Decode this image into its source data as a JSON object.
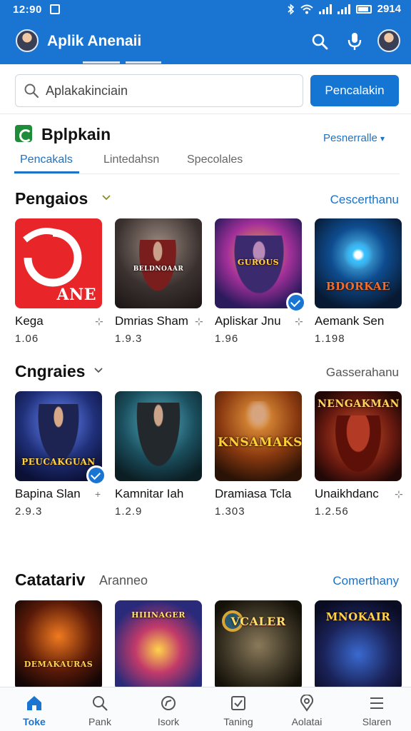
{
  "status_bar": {
    "time": "12:90",
    "battery_text": "2914"
  },
  "app_bar": {
    "title": "Aplik Anenaii"
  },
  "search": {
    "placeholder": "Aplakakinciain",
    "button_label": "Pencalakin"
  },
  "featured": {
    "title": "Bplpkain",
    "link": "Pesnerralle",
    "tabs": [
      "Pencakals",
      "Lintedahsn",
      "Specolales"
    ]
  },
  "sections": [
    {
      "title": "Pengaios",
      "subtitle": "",
      "link": "Cescerthanu",
      "items": [
        {
          "name": "Kega",
          "count": "1.06",
          "art_text": "ANE",
          "verified": false
        },
        {
          "name": "Dmrias Sham",
          "count": "1.9.3",
          "art_text": "BELDNOAAR",
          "verified": false
        },
        {
          "name": "Apliskar Jnu",
          "count": "1.96",
          "art_text": "GUROUS",
          "verified": true
        },
        {
          "name": "Aemank Sen",
          "count": "1.198",
          "art_text": "BDORKAE",
          "verified": false
        }
      ]
    },
    {
      "title": "Cngraies",
      "subtitle": "",
      "link": "Gasserahanu",
      "items": [
        {
          "name": "Bapina Slan",
          "count": "2.9.3",
          "art_text": "PEUCAKGUAN",
          "verified": true
        },
        {
          "name": "Kamnitar Iah",
          "count": "1.2.9",
          "art_text": "",
          "verified": false
        },
        {
          "name": "Dramiasa Tcla",
          "count": "1.303",
          "art_text": "KNSAMAKS",
          "verified": false
        },
        {
          "name": "Unaikhdanc",
          "count": "1.2.56",
          "art_text": "NENGAKMAN",
          "verified": false
        }
      ]
    },
    {
      "title": "Catatariv",
      "subtitle": "Aranneo",
      "link": "Comerthany",
      "items": [
        {
          "name": "",
          "count": "",
          "art_text": "DEMAKAURAS",
          "verified": false
        },
        {
          "name": "",
          "count": "",
          "art_text": "HIIINAGER",
          "verified": false
        },
        {
          "name": "",
          "count": "",
          "art_text": "VCALER",
          "verified": false
        },
        {
          "name": "",
          "count": "",
          "art_text": "MNOKAIR",
          "verified": false
        }
      ]
    }
  ],
  "bottom_nav": [
    {
      "label": "Toke",
      "icon": "home-icon",
      "active": true
    },
    {
      "label": "Pank",
      "icon": "search-icon",
      "active": false
    },
    {
      "label": "Isork",
      "icon": "explore-icon",
      "active": false
    },
    {
      "label": "Taning",
      "icon": "checkbox-icon",
      "active": false
    },
    {
      "label": "Aolatai",
      "icon": "location-icon",
      "active": false
    },
    {
      "label": "Slaren",
      "icon": "menu-icon",
      "active": false
    }
  ],
  "colors": {
    "primary": "#1a74d2",
    "link": "#1d72c4",
    "brand_green": "#1f8c3a"
  }
}
